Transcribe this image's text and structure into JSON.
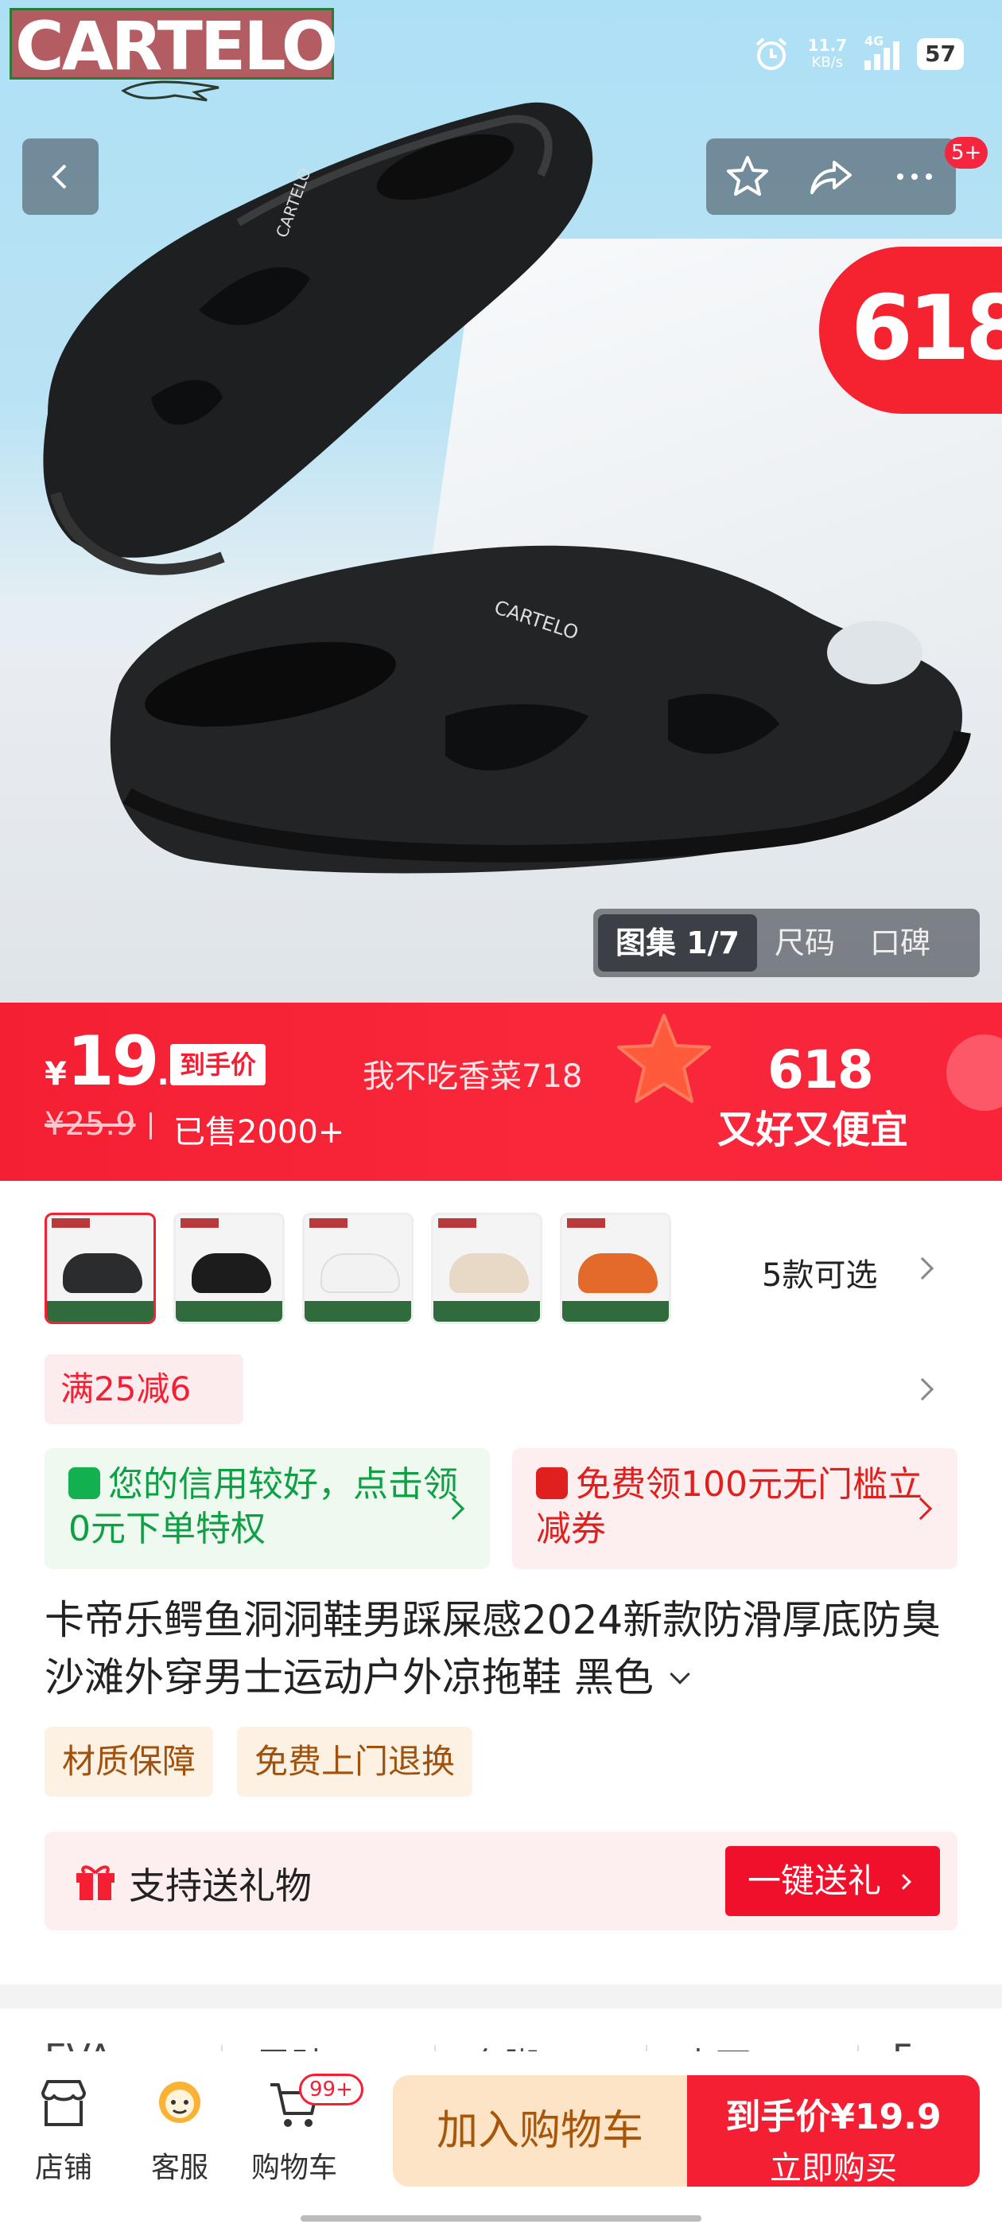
{
  "status_bar": {
    "brand_logo": "CARTELO",
    "net_speed_value": "11.7",
    "net_speed_unit": "KB/s",
    "network": "4G",
    "battery": "57"
  },
  "hero": {
    "more_badge": "5+",
    "promo_badge": "618",
    "gallery_tabs": [
      "图集 1/7",
      "尺码",
      "口碑"
    ]
  },
  "price": {
    "currency": "¥",
    "integer": "19",
    "decimal": ".9",
    "tag": "到手价",
    "original": "¥25.9",
    "sold": "已售2000+",
    "seller": "我不吃香菜718",
    "event_num": "618",
    "event_slogan": "又好又便宜"
  },
  "sku": {
    "count_label": "5款可选",
    "items": [
      {
        "color": "#2a2c2e"
      },
      {
        "color": "#1c1c1c"
      },
      {
        "color": "#f2f2f2"
      },
      {
        "color": "#e8d8c6"
      },
      {
        "color": "#e46a2b"
      }
    ]
  },
  "coupon": "满25减6",
  "cards": {
    "credit": "您的信用较好，点击领0元下单特权",
    "voucher": "免费领100元无门槛立减券"
  },
  "title": "卡帝乐鳄鱼洞洞鞋男踩屎感2024新款防滑厚底防臭沙滩外穿男士运动户外凉拖鞋 黑色",
  "tags": [
    "材质保障",
    "免费上门退换"
  ],
  "gift": {
    "label": "支持送礼物",
    "button": "一键送礼"
  },
  "attributes": [
    "EVA",
    "雷趾",
    "套脚",
    "表面",
    "F"
  ],
  "bottom_bar": {
    "shop": "店铺",
    "service": "客服",
    "cart": "购物车",
    "cart_badge": "99+",
    "add_to_cart": "加入购物车",
    "buy_price_label": "到手价¥19.9",
    "buy_now": "立即购买"
  },
  "colors": {
    "accent": "#f51f33",
    "green": "#0f9f45",
    "cart_btn_bg": "#fde4c6"
  }
}
